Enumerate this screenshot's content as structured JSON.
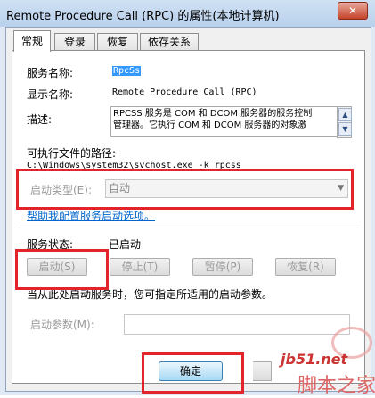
{
  "window": {
    "title": "Remote Procedure Call (RPC) 的属性(本地计算机)",
    "close_glyph": "✕"
  },
  "tabs": [
    {
      "label": "常规",
      "active": true
    },
    {
      "label": "登录",
      "active": false
    },
    {
      "label": "恢复",
      "active": false
    },
    {
      "label": "依存关系",
      "active": false
    }
  ],
  "general": {
    "service_name_label": "服务名称:",
    "service_name_value": "RpcSs",
    "display_name_label": "显示名称:",
    "display_name_value": "Remote Procedure Call (RPC)",
    "description_label": "描述:",
    "description_value": "RPCSS 服务是 COM 和 DCOM 服务器的服务控制\n管理器。它执行 COM 和 DCOM 服务器的对象激",
    "path_label": "可执行文件的路径:",
    "path_value": "C:\\Windows\\system32\\svchost.exe -k rpcss",
    "startup_type_label": "启动类型(E):",
    "startup_type_value": "自动",
    "help_link": "帮助我配置服务启动选项。",
    "status_label": "服务状态:",
    "status_value": "已启动",
    "buttons": {
      "start": "启动(S)",
      "stop": "停止(T)",
      "pause": "暂停(P)",
      "resume": "恢复(R)"
    },
    "start_params_hint": "当从此处启动服务时，您可指定所适用的启动参数。",
    "start_params_label": "启动参数(M):",
    "start_params_value": ""
  },
  "footer": {
    "ok": "确定"
  },
  "watermark": {
    "site": "jb51.net",
    "brand": "脚本之家"
  },
  "colors": {
    "highlight_box": "#e3242b",
    "link": "#0066cc",
    "selection": "#3399ff"
  }
}
